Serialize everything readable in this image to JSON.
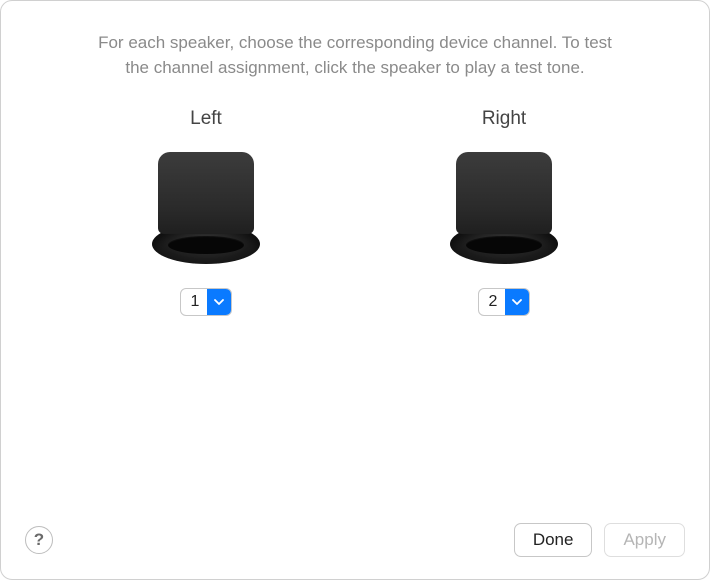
{
  "instructions": {
    "line1": "For each speaker, choose the corresponding device channel. To test",
    "line2": "the channel assignment, click the speaker to play a test tone."
  },
  "speakers": {
    "left": {
      "label": "Left",
      "channel_value": "1"
    },
    "right": {
      "label": "Right",
      "channel_value": "2"
    }
  },
  "footer": {
    "help_label": "?",
    "done_label": "Done",
    "apply_label": "Apply"
  }
}
